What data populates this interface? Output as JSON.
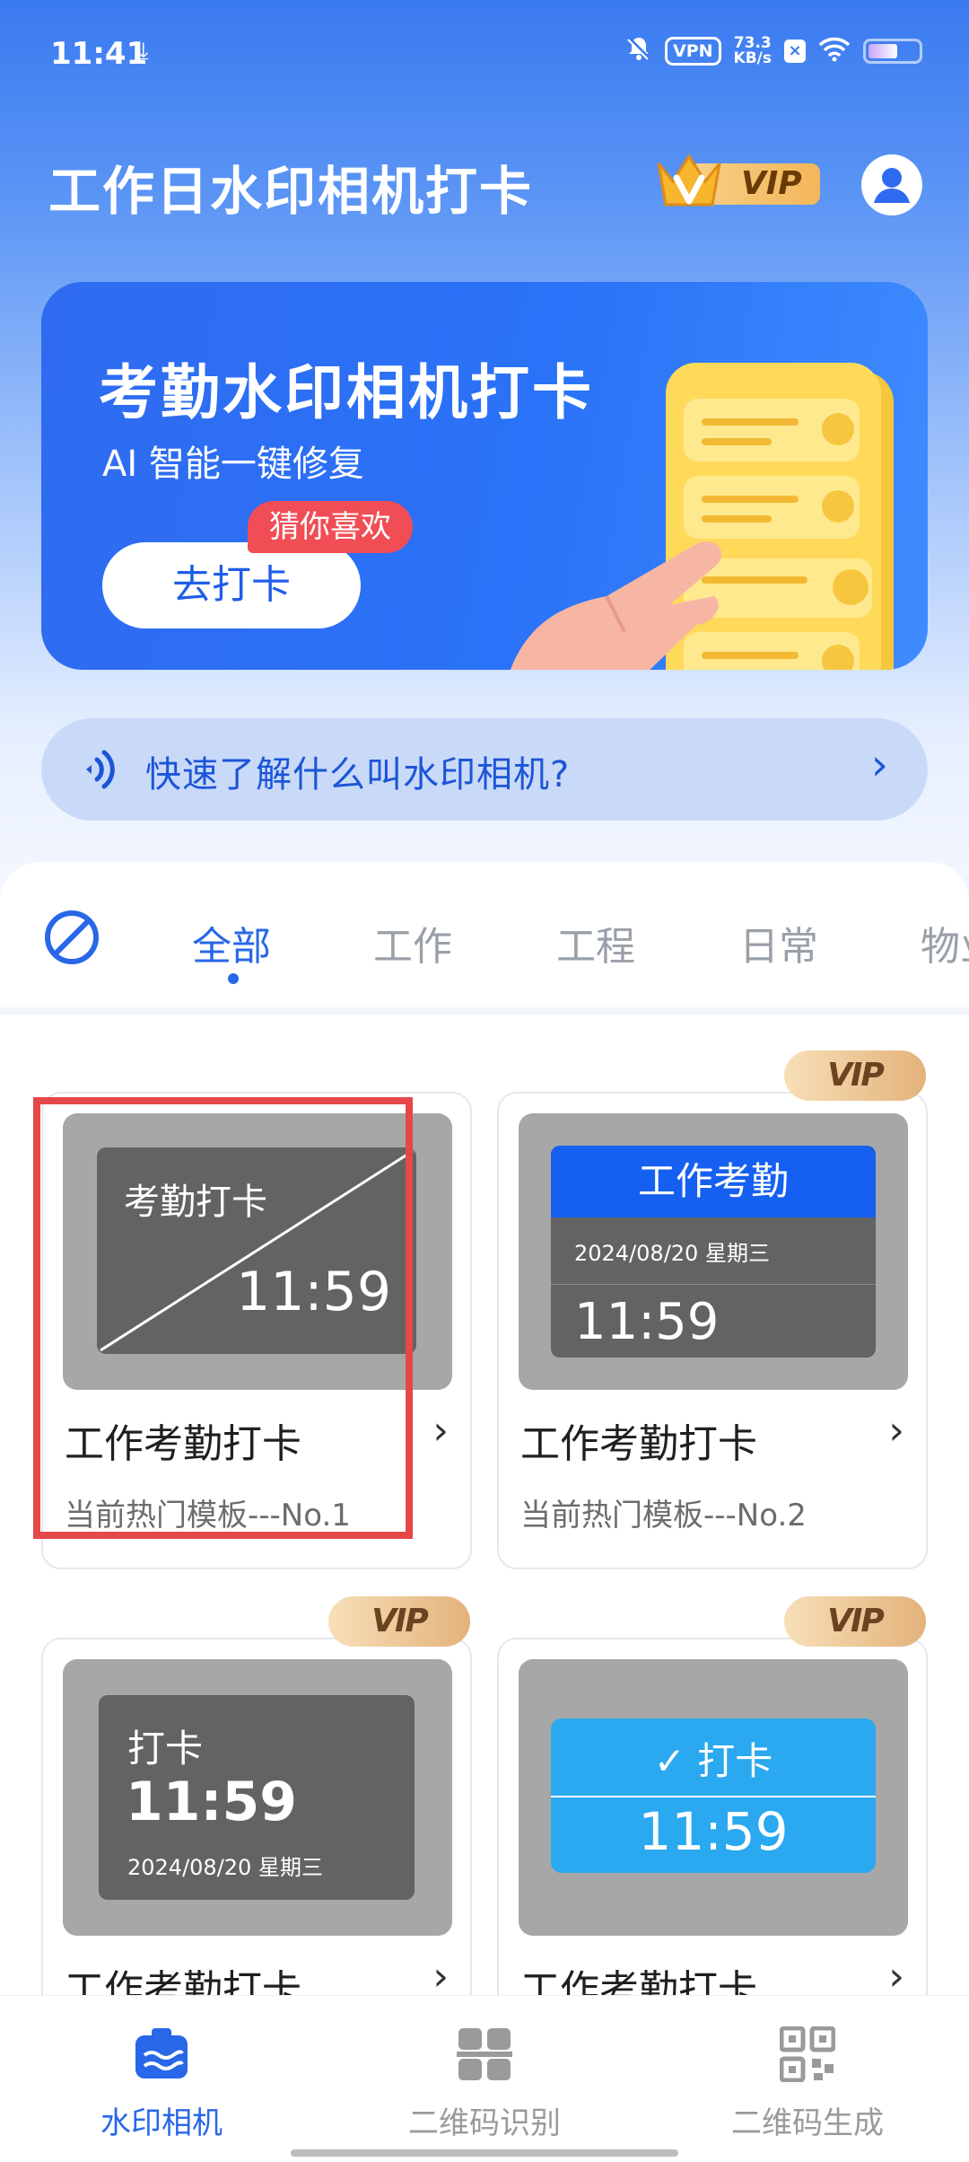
{
  "status_bar": {
    "time": "11:41",
    "vpn": "VPN",
    "speed_value": "73.3",
    "speed_unit": "KB/s"
  },
  "header": {
    "title": "工作日水印相机打卡",
    "vip_label": "VIP"
  },
  "banner": {
    "headline": "考勤水印相机打卡",
    "subtitle": "AI 智能一键修复",
    "button_label": "去打卡",
    "tag_label": "猜你喜欢"
  },
  "info_pill": {
    "text": "快速了解什么叫水印相机?"
  },
  "tabs": [
    {
      "label": "全部",
      "active": true
    },
    {
      "label": "工作"
    },
    {
      "label": "工程"
    },
    {
      "label": "日常"
    },
    {
      "label": "物业"
    }
  ],
  "templates": [
    {
      "name": "工作考勤打卡",
      "desc": "当前热门模板---No.1",
      "vip": false,
      "wm_title": "考勤打卡",
      "wm_time": "11:59"
    },
    {
      "name": "工作考勤打卡",
      "desc": "当前热门模板---No.2",
      "vip": true,
      "vip_label": "VIP",
      "wm_title": "工作考勤",
      "wm_date": "2024/08/20  星期三",
      "wm_time": "11:59"
    },
    {
      "name": "工作考勤打卡",
      "vip": true,
      "vip_label": "VIP",
      "wm_title": "打卡",
      "wm_time": "11:59",
      "wm_date": "2024/08/20  星期三"
    },
    {
      "name": "工作考勤打卡",
      "vip": true,
      "vip_label": "VIP",
      "wm_title": "打卡",
      "wm_time": "11:59"
    }
  ],
  "bottom_nav": [
    {
      "label": "水印相机",
      "active": true
    },
    {
      "label": "二维码识别"
    },
    {
      "label": "二维码生成"
    }
  ],
  "colors": {
    "primary": "#2867e7",
    "highlight": "#e54848",
    "vip_gold": "#e3b27a"
  }
}
